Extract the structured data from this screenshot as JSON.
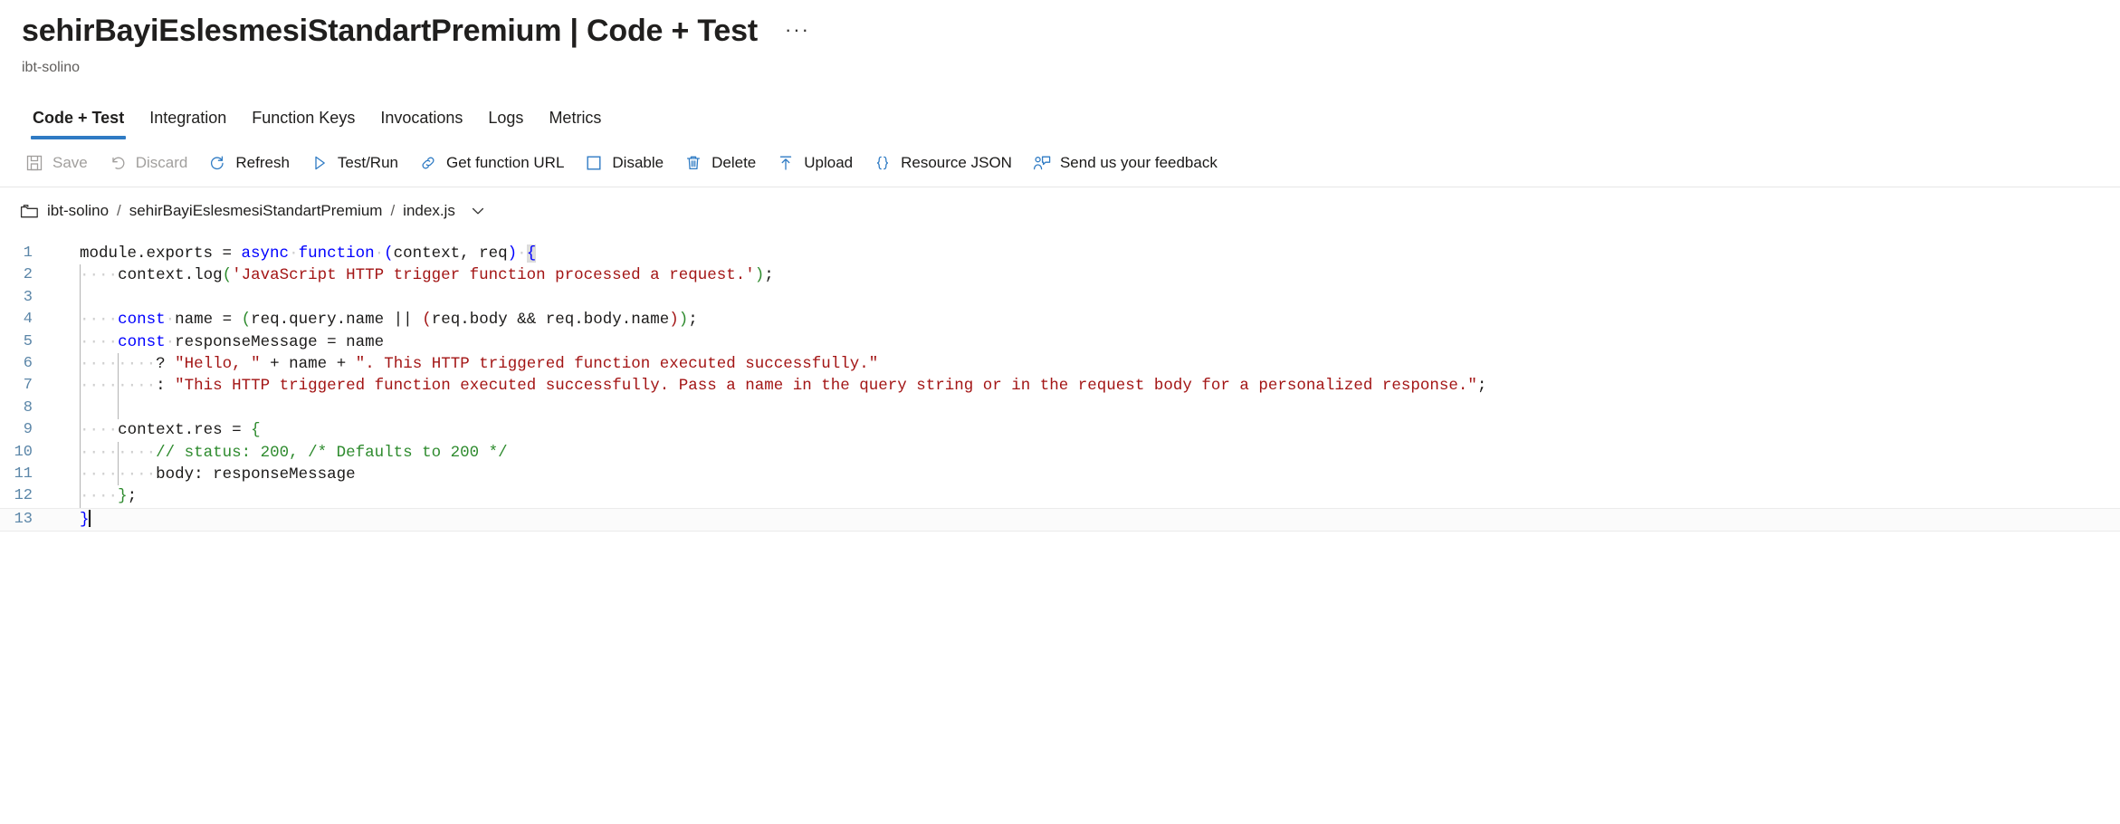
{
  "header": {
    "title": "sehirBayiEslesmesiStandartPremium | Code + Test",
    "ellipsis": "···",
    "subtitle": "ibt-solino"
  },
  "tabs": [
    {
      "label": "Code + Test",
      "active": true
    },
    {
      "label": "Integration",
      "active": false
    },
    {
      "label": "Function Keys",
      "active": false
    },
    {
      "label": "Invocations",
      "active": false
    },
    {
      "label": "Logs",
      "active": false
    },
    {
      "label": "Metrics",
      "active": false
    }
  ],
  "commands": [
    {
      "label": "Save",
      "icon": "save-icon",
      "disabled": true
    },
    {
      "label": "Discard",
      "icon": "discard-icon",
      "disabled": true
    },
    {
      "label": "Refresh",
      "icon": "refresh-icon",
      "disabled": false
    },
    {
      "label": "Test/Run",
      "icon": "play-icon",
      "disabled": false
    },
    {
      "label": "Get function URL",
      "icon": "link-icon",
      "disabled": false
    },
    {
      "label": "Disable",
      "icon": "square-icon",
      "disabled": false
    },
    {
      "label": "Delete",
      "icon": "trash-icon",
      "disabled": false
    },
    {
      "label": "Upload",
      "icon": "upload-arrow-icon",
      "disabled": false
    },
    {
      "label": "Resource JSON",
      "icon": "braces-icon",
      "disabled": false
    },
    {
      "label": "Send us your feedback",
      "icon": "feedback-person-icon",
      "disabled": false
    }
  ],
  "file_bar": {
    "folder_icon": "folder-icon",
    "crumb1": "ibt-solino",
    "sep1": "/",
    "crumb2": "sehirBayiEslesmesiStandartPremium",
    "sep2": "/",
    "file": "index.js",
    "chevron_icon": "chevron-down-icon"
  },
  "editor": {
    "language": "javascript",
    "cursor_line": 13,
    "line_numbers": [
      "1",
      "2",
      "3",
      "4",
      "5",
      "6",
      "7",
      "8",
      "9",
      "10",
      "11",
      "12",
      "13"
    ],
    "lines": [
      {
        "n": "1",
        "indent": 0,
        "guides": 0,
        "tokens": [
          {
            "t": "module.exports ",
            "c": "plain"
          },
          {
            "t": "= ",
            "c": "plain"
          },
          {
            "t": "async",
            "c": "kw"
          },
          {
            "t": " ",
            "c": "ws"
          },
          {
            "t": "function",
            "c": "kw"
          },
          {
            "t": " ",
            "c": "ws"
          },
          {
            "t": "(",
            "c": "br3"
          },
          {
            "t": "context, req",
            "c": "plain"
          },
          {
            "t": ")",
            "c": "br3"
          },
          {
            "t": " ",
            "c": "ws"
          },
          {
            "t": "{",
            "c": "br3 brhl"
          }
        ]
      },
      {
        "n": "2",
        "indent": 1,
        "guides": 1,
        "tokens": [
          {
            "t": "context.log",
            "c": "plain"
          },
          {
            "t": "(",
            "c": "br1"
          },
          {
            "t": "'JavaScript HTTP trigger function processed a request.'",
            "c": "str"
          },
          {
            "t": ")",
            "c": "br1"
          },
          {
            "t": ";",
            "c": "plain"
          }
        ]
      },
      {
        "n": "3",
        "indent": 0,
        "guides": 1,
        "tokens": []
      },
      {
        "n": "4",
        "indent": 1,
        "guides": 1,
        "tokens": [
          {
            "t": "const",
            "c": "kw"
          },
          {
            "t": " ",
            "c": "ws"
          },
          {
            "t": "name ",
            "c": "plain"
          },
          {
            "t": "= ",
            "c": "plain"
          },
          {
            "t": "(",
            "c": "br1"
          },
          {
            "t": "req.query.name ",
            "c": "plain"
          },
          {
            "t": "|| ",
            "c": "plain"
          },
          {
            "t": "(",
            "c": "br2"
          },
          {
            "t": "req.body && req.body.name",
            "c": "plain"
          },
          {
            "t": ")",
            "c": "br2"
          },
          {
            "t": ")",
            "c": "br1"
          },
          {
            "t": ";",
            "c": "plain"
          }
        ]
      },
      {
        "n": "5",
        "indent": 1,
        "guides": 1,
        "tokens": [
          {
            "t": "const",
            "c": "kw"
          },
          {
            "t": " ",
            "c": "ws"
          },
          {
            "t": "responseMessage ",
            "c": "plain"
          },
          {
            "t": "= ",
            "c": "plain"
          },
          {
            "t": "name",
            "c": "plain"
          }
        ]
      },
      {
        "n": "6",
        "indent": 2,
        "guides": 2,
        "tokens": [
          {
            "t": "? ",
            "c": "plain"
          },
          {
            "t": "\"Hello, \"",
            "c": "str"
          },
          {
            "t": " + ",
            "c": "plain"
          },
          {
            "t": "name",
            "c": "plain"
          },
          {
            "t": " + ",
            "c": "plain"
          },
          {
            "t": "\". This HTTP triggered function executed successfully.\"",
            "c": "str"
          }
        ]
      },
      {
        "n": "7",
        "indent": 2,
        "guides": 2,
        "tokens": [
          {
            "t": ": ",
            "c": "plain"
          },
          {
            "t": "\"This HTTP triggered function executed successfully. Pass a name in the query string or in the request body for a personalized response.\"",
            "c": "str"
          },
          {
            "t": ";",
            "c": "plain"
          }
        ]
      },
      {
        "n": "8",
        "indent": 0,
        "guides": 2,
        "tokens": []
      },
      {
        "n": "9",
        "indent": 1,
        "guides": 1,
        "tokens": [
          {
            "t": "context.res ",
            "c": "plain"
          },
          {
            "t": "= ",
            "c": "plain"
          },
          {
            "t": "{",
            "c": "br1"
          }
        ]
      },
      {
        "n": "10",
        "indent": 2,
        "guides": 2,
        "tokens": [
          {
            "t": "// status: 200, /* Defaults to 200 */",
            "c": "com"
          }
        ]
      },
      {
        "n": "11",
        "indent": 2,
        "guides": 2,
        "tokens": [
          {
            "t": "body: ",
            "c": "plain"
          },
          {
            "t": "responseMessage",
            "c": "plain"
          }
        ]
      },
      {
        "n": "12",
        "indent": 1,
        "guides": 1,
        "tokens": [
          {
            "t": "}",
            "c": "br1"
          },
          {
            "t": ";",
            "c": "plain"
          }
        ]
      },
      {
        "n": "13",
        "indent": 0,
        "guides": 0,
        "current": true,
        "tokens": [
          {
            "t": "}",
            "c": "br3"
          }
        ]
      }
    ],
    "raw_code": "module.exports = async function (context, req) {\n    context.log('JavaScript HTTP trigger function processed a request.');\n\n    const name = (req.query.name || (req.body && req.body.name));\n    const responseMessage = name\n        ? \"Hello, \" + name + \". This HTTP triggered function executed successfully.\"\n        : \"This HTTP triggered function executed successfully. Pass a name in the query string or in the request body for a personalized response.\";\n\n    context.res = {\n        // status: 200, /* Defaults to 200 */\n        body: responseMessage\n    };\n}"
  },
  "colors": {
    "accent": "#2f7bc4",
    "text": "#1b1a19",
    "muted": "#605e5c",
    "disabled": "#a19f9d",
    "keyword": "#0000ff",
    "string": "#a31515",
    "comment": "#2e8b2e",
    "line_number": "#5b86a8",
    "current_line_bg": "#fbfbfb"
  }
}
